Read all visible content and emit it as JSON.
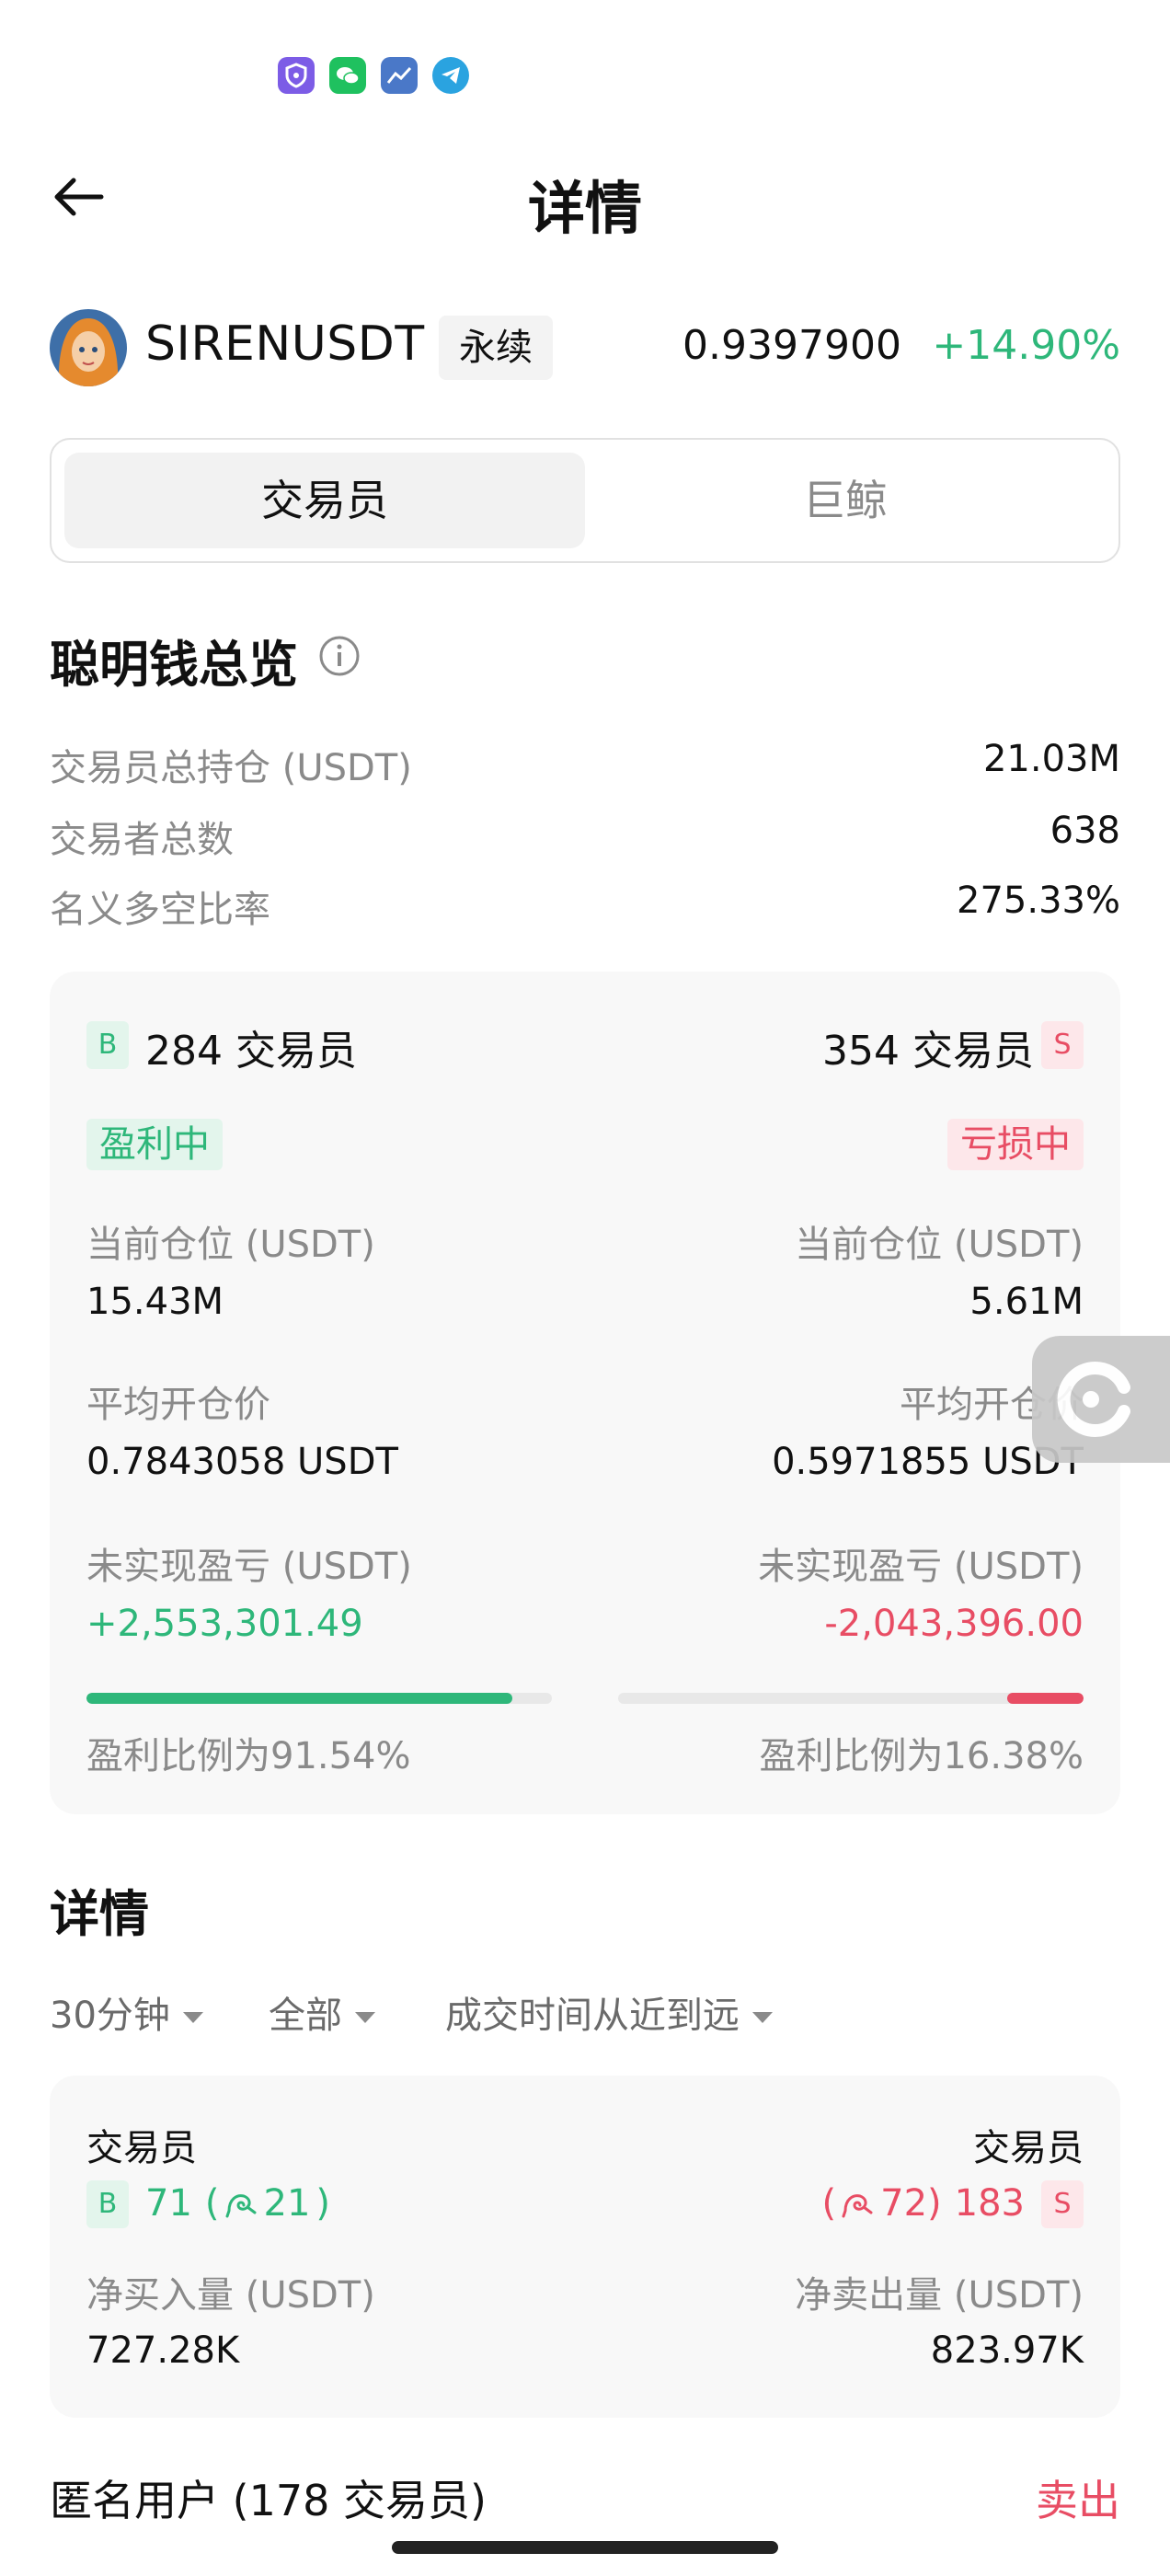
{
  "status_bar": {
    "icons": [
      "vpn-shield-icon",
      "wechat-icon",
      "chart-app-icon",
      "telegram-icon"
    ]
  },
  "header": {
    "title": "详情"
  },
  "ticker": {
    "symbol": "SIRENUSDT",
    "contract_type": "永续",
    "price": "0.9397900",
    "change": "+14.90%"
  },
  "tabs": [
    {
      "label": "交易员",
      "active": true
    },
    {
      "label": "巨鲸",
      "active": false
    }
  ],
  "overview": {
    "title": "聪明钱总览",
    "rows": [
      {
        "label": "交易员总持仓 (USDT)",
        "value": "21.03M"
      },
      {
        "label": "交易者总数",
        "value": "638"
      },
      {
        "label": "名义多空比率",
        "value": "275.33%"
      }
    ]
  },
  "summary_card": {
    "buy": {
      "tag": "B",
      "count_text": "284 交易员",
      "status": "盈利中",
      "position_label": "当前仓位 (USDT)",
      "position_value": "15.43M",
      "avg_price_label": "平均开仓价",
      "avg_price_value": "0.7843058 USDT",
      "pnl_label": "未实现盈亏 (USDT)",
      "pnl_value": "+2,553,301.49",
      "profit_ratio": 0.9154,
      "profit_text": "盈利比例为91.54%"
    },
    "sell": {
      "tag": "S",
      "count_text": "354 交易员",
      "status": "亏损中",
      "position_label": "当前仓位 (USDT)",
      "position_value": "5.61M",
      "avg_price_label": "平均开仓价",
      "avg_price_value": "0.5971855 USDT",
      "pnl_label": "未实现盈亏 (USDT)",
      "pnl_value": "-2,043,396.00",
      "profit_ratio": 0.1638,
      "profit_text": "盈利比例为16.38%"
    }
  },
  "details": {
    "title": "详情",
    "filters": [
      "30分钟",
      "全部",
      "成交时间从近到远"
    ],
    "card": {
      "left_title": "交易员",
      "right_title": "交易员",
      "buy_tag": "B",
      "buy_count": "71",
      "buy_whale": "21",
      "sell_whale": "72",
      "sell_count": "183",
      "sell_tag": "S",
      "net_buy_label": "净买入量 (USDT)",
      "net_buy_value": "727.28K",
      "net_sell_label": "净卖出量 (USDT)",
      "net_sell_value": "823.97K"
    },
    "anon_row": {
      "label": "匿名用户 (178 交易员)",
      "action": "卖出"
    }
  },
  "colors": {
    "green": "#2eb77a",
    "red": "#e84d64",
    "gray_text": "#8a8a8a"
  }
}
